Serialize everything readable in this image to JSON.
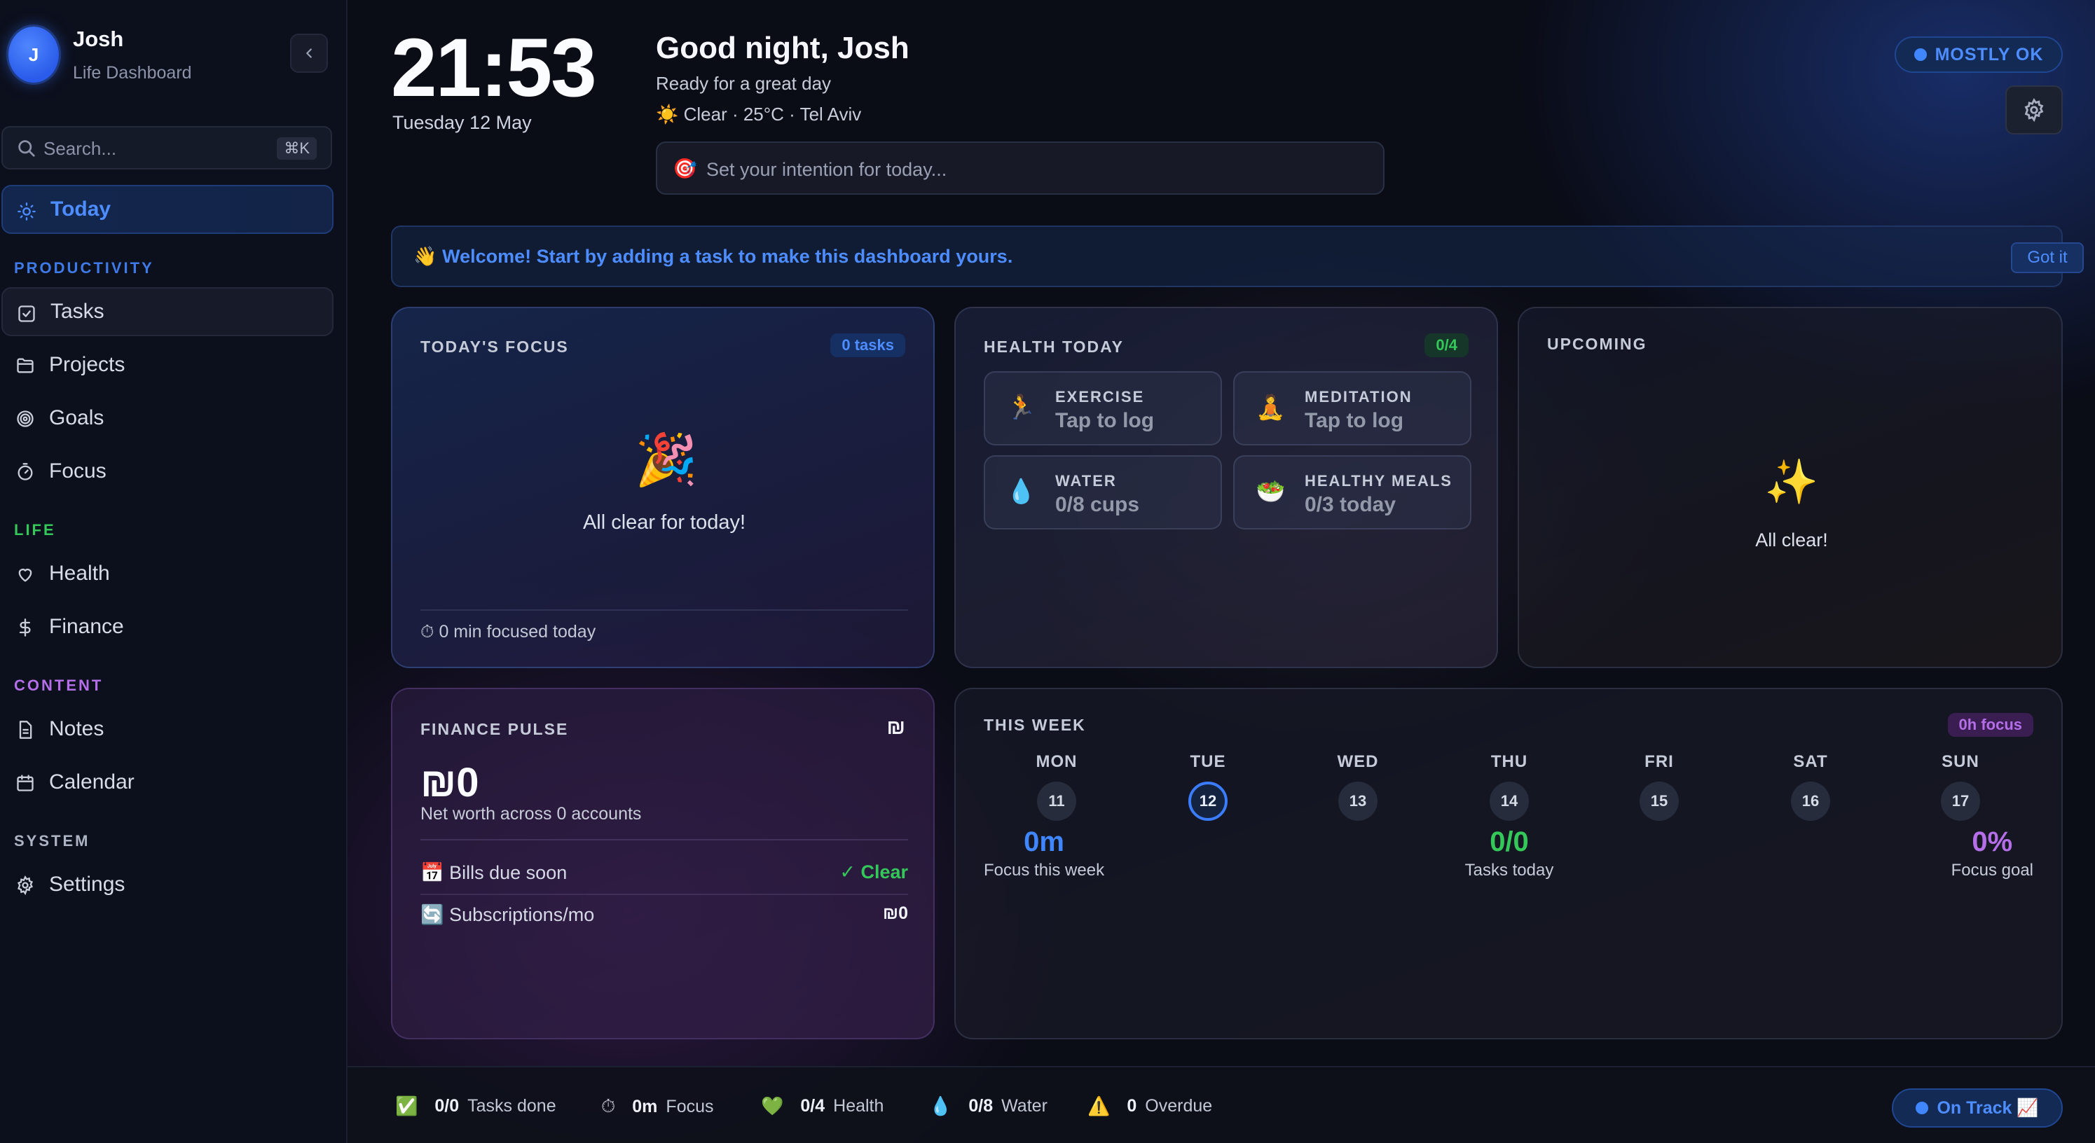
{
  "profile": {
    "initial": "J",
    "name": "Josh",
    "subtitle": "Life Dashboard"
  },
  "search": {
    "placeholder": "Search...",
    "shortcut": "⌘K"
  },
  "nav": {
    "today": "Today",
    "sections": {
      "productivity": "PRODUCTIVITY",
      "life": "LIFE",
      "content": "CONTENT",
      "system": "SYSTEM"
    },
    "items": {
      "tasks": "Tasks",
      "projects": "Projects",
      "goals": "Goals",
      "focus": "Focus",
      "health": "Health",
      "finance": "Finance",
      "notes": "Notes",
      "calendar": "Calendar",
      "settings": "Settings"
    }
  },
  "colors": {
    "accent": "#4d8dff",
    "productivity": "#3f7be8",
    "life": "#34c759",
    "content": "#b46ee8",
    "system": "#aeb4c4",
    "green": "#34c759",
    "purple": "#b46ee8"
  },
  "header": {
    "time": "21:53",
    "date": "Tuesday 12 May",
    "greeting": "Good night, Josh",
    "subtitle": "Ready for a great day",
    "weather": "☀️ Clear · 25°C · Tel Aviv",
    "intention_icon": "🎯",
    "intention_placeholder": "Set your intention for today...",
    "status": "MOSTLY OK"
  },
  "banner": {
    "text": "👋 Welcome! Start by adding a task to make this dashboard yours.",
    "button": "Got it"
  },
  "focus_card": {
    "title": "TODAY'S FOCUS",
    "badge": "0 tasks",
    "emoji": "🎉",
    "empty": "All clear for today!",
    "footer": "⏱ 0 min focused today"
  },
  "health_card": {
    "title": "HEALTH TODAY",
    "badge": "0/4",
    "tiles": [
      {
        "icon": "🏃",
        "label": "EXERCISE",
        "value": "Tap to log"
      },
      {
        "icon": "🧘",
        "label": "MEDITATION",
        "value": "Tap to log"
      },
      {
        "icon": "💧",
        "label": "WATER",
        "value": "0/8 cups"
      },
      {
        "icon": "🥗",
        "label": "HEALTHY MEALS",
        "value": "0/3 today"
      }
    ]
  },
  "upcoming_card": {
    "title": "UPCOMING",
    "emoji": "✨",
    "empty": "All clear!"
  },
  "finance_card": {
    "title": "FINANCE PULSE",
    "currency_icon": "₪",
    "net_worth": "₪0",
    "subtitle": "Net worth across 0 accounts",
    "rows": [
      {
        "label": "📅 Bills due soon",
        "value": "✓ Clear"
      },
      {
        "label": "🔄 Subscriptions/mo",
        "value": "₪0"
      }
    ]
  },
  "week_card": {
    "title": "THIS WEEK",
    "badge": "0h focus",
    "days": [
      {
        "name": "MON",
        "num": "11"
      },
      {
        "name": "TUE",
        "num": "12"
      },
      {
        "name": "WED",
        "num": "13"
      },
      {
        "name": "THU",
        "num": "14"
      },
      {
        "name": "FRI",
        "num": "15"
      },
      {
        "name": "SAT",
        "num": "16"
      },
      {
        "name": "SUN",
        "num": "17"
      }
    ],
    "stats": [
      {
        "value": "0m",
        "label": "Focus this week"
      },
      {
        "value": "0/0",
        "label": "Tasks today"
      },
      {
        "value": "0%",
        "label": "Focus goal"
      }
    ]
  },
  "bottom_bar": {
    "stats": [
      {
        "icon": "✅",
        "value": "0/0",
        "label": "Tasks done"
      },
      {
        "icon": "⏱",
        "value": "0m",
        "label": "Focus"
      },
      {
        "icon": "💚",
        "value": "0/4",
        "label": "Health"
      },
      {
        "icon": "💧",
        "value": "0/8",
        "label": "Water"
      },
      {
        "icon": "⚠️",
        "value": "0",
        "label": "Overdue"
      }
    ],
    "status": "On Track 📈"
  }
}
